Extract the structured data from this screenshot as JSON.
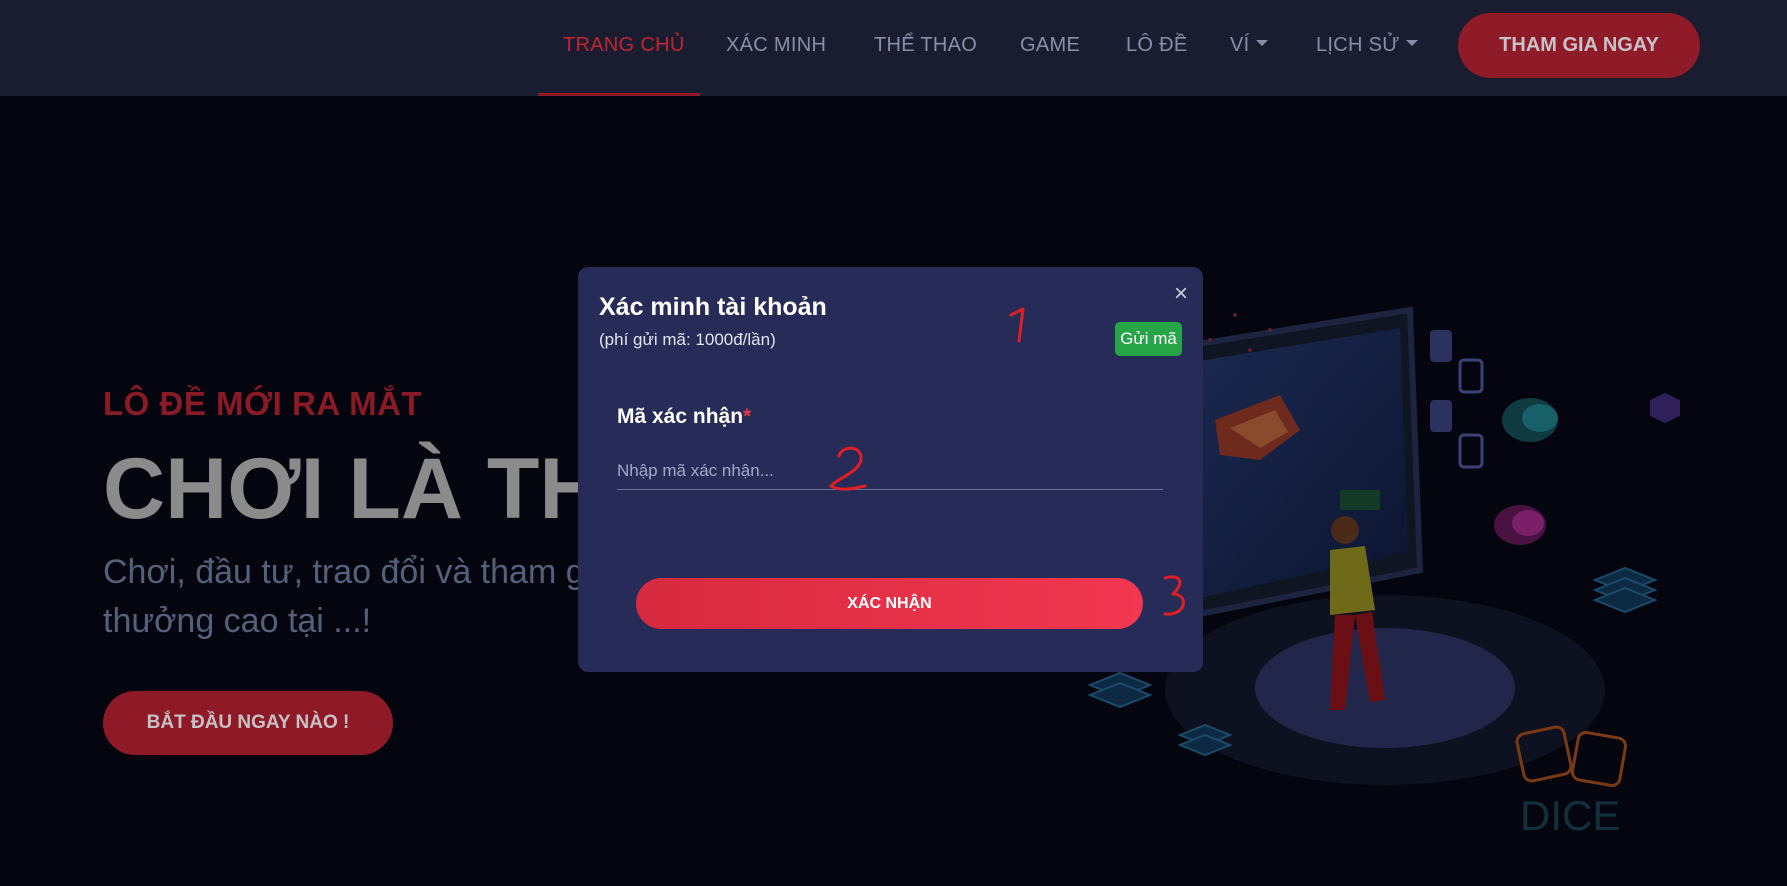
{
  "nav": {
    "items": [
      {
        "label": "TRANG CHỦ"
      },
      {
        "label": "XÁC MINH"
      },
      {
        "label": "THỂ THAO"
      },
      {
        "label": "GAME"
      },
      {
        "label": "LÔ ĐỀ"
      },
      {
        "label": "VÍ"
      },
      {
        "label": "LỊCH SỬ"
      }
    ],
    "join_label": "THAM GIA NGAY"
  },
  "hero": {
    "eyebrow": "LÔ ĐỀ MỚI RA MẮT",
    "title": "CHƠI LÀ TH",
    "desc": "Chơi, đầu tư, trao đổi và tham gi thưởng cao tại ...!",
    "cta_label": "BẮT ĐẦU NGAY NÀO !",
    "dice_label": "DICE"
  },
  "modal": {
    "title": "Xác minh tài khoản",
    "subtitle": "(phí gửi mã: 1000đ/lần)",
    "close_label": "×",
    "send_label": "Gửi mã",
    "field_label": "Mã xác nhận",
    "required_mark": "*",
    "input_placeholder": "Nhập mã xác nhận...",
    "input_value": "",
    "confirm_label": "XÁC NHẬN"
  },
  "annotations": [
    "1",
    "2",
    "3"
  ],
  "colors": {
    "accent_red": "#c02432",
    "modal_bg": "#262c57",
    "send_green": "#27a546",
    "confirm_red": "#f23751"
  }
}
